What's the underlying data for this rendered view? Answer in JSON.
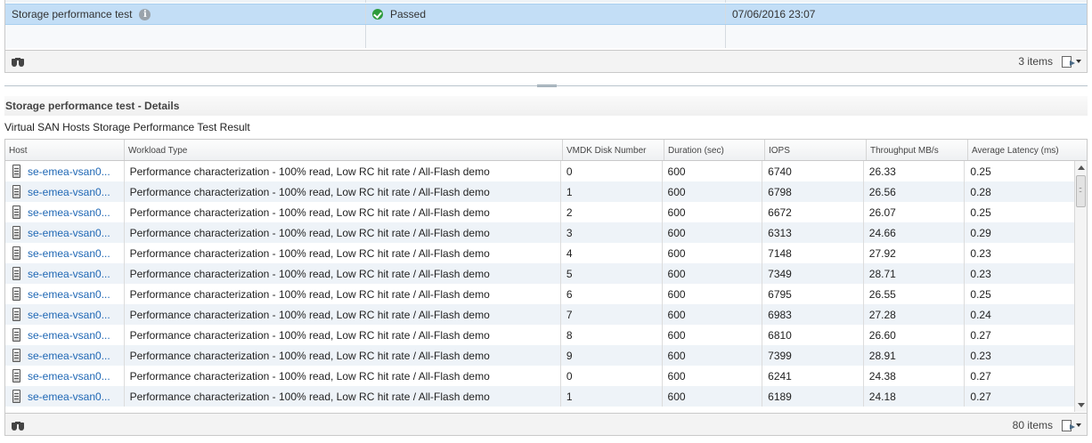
{
  "top_table": {
    "row": {
      "name": "Storage performance test",
      "status": "Passed",
      "timestamp": "07/06/2016 23:07"
    },
    "items_count": "3 items"
  },
  "details": {
    "header": "Storage performance test - Details",
    "subtitle": "Virtual SAN Hosts Storage Performance Test Result",
    "columns": [
      "Host",
      "Workload Type",
      "VMDK Disk Number",
      "Duration (sec)",
      "IOPS",
      "Throughput MB/s",
      "Average Latency (ms)"
    ],
    "rows": [
      {
        "host": "se-emea-vsan0...",
        "workload": "Performance characterization - 100% read, Low RC hit rate / All-Flash demo",
        "disk": "0",
        "duration": "600",
        "iops": "6740",
        "throughput": "26.33",
        "latency": "0.25"
      },
      {
        "host": "se-emea-vsan0...",
        "workload": "Performance characterization - 100% read, Low RC hit rate / All-Flash demo",
        "disk": "1",
        "duration": "600",
        "iops": "6798",
        "throughput": "26.56",
        "latency": "0.28"
      },
      {
        "host": "se-emea-vsan0...",
        "workload": "Performance characterization - 100% read, Low RC hit rate / All-Flash demo",
        "disk": "2",
        "duration": "600",
        "iops": "6672",
        "throughput": "26.07",
        "latency": "0.25"
      },
      {
        "host": "se-emea-vsan0...",
        "workload": "Performance characterization - 100% read, Low RC hit rate / All-Flash demo",
        "disk": "3",
        "duration": "600",
        "iops": "6313",
        "throughput": "24.66",
        "latency": "0.29"
      },
      {
        "host": "se-emea-vsan0...",
        "workload": "Performance characterization - 100% read, Low RC hit rate / All-Flash demo",
        "disk": "4",
        "duration": "600",
        "iops": "7148",
        "throughput": "27.92",
        "latency": "0.23"
      },
      {
        "host": "se-emea-vsan0...",
        "workload": "Performance characterization - 100% read, Low RC hit rate / All-Flash demo",
        "disk": "5",
        "duration": "600",
        "iops": "7349",
        "throughput": "28.71",
        "latency": "0.23"
      },
      {
        "host": "se-emea-vsan0...",
        "workload": "Performance characterization - 100% read, Low RC hit rate / All-Flash demo",
        "disk": "6",
        "duration": "600",
        "iops": "6795",
        "throughput": "26.55",
        "latency": "0.25"
      },
      {
        "host": "se-emea-vsan0...",
        "workload": "Performance characterization - 100% read, Low RC hit rate / All-Flash demo",
        "disk": "7",
        "duration": "600",
        "iops": "6983",
        "throughput": "27.28",
        "latency": "0.24"
      },
      {
        "host": "se-emea-vsan0...",
        "workload": "Performance characterization - 100% read, Low RC hit rate / All-Flash demo",
        "disk": "8",
        "duration": "600",
        "iops": "6810",
        "throughput": "26.60",
        "latency": "0.27"
      },
      {
        "host": "se-emea-vsan0...",
        "workload": "Performance characterization - 100% read, Low RC hit rate / All-Flash demo",
        "disk": "9",
        "duration": "600",
        "iops": "7399",
        "throughput": "28.91",
        "latency": "0.23"
      },
      {
        "host": "se-emea-vsan0...",
        "workload": "Performance characterization - 100% read, Low RC hit rate / All-Flash demo",
        "disk": "0",
        "duration": "600",
        "iops": "6241",
        "throughput": "24.38",
        "latency": "0.27"
      },
      {
        "host": "se-emea-vsan0...",
        "workload": "Performance characterization - 100% read, Low RC hit rate / All-Flash demo",
        "disk": "1",
        "duration": "600",
        "iops": "6189",
        "throughput": "24.18",
        "latency": "0.27"
      }
    ],
    "items_count": "80 items"
  },
  "icons": {
    "info": "info-icon",
    "status": "check-circle-icon",
    "host": "server-icon",
    "filter": "binoculars-icon",
    "export": "export-icon"
  },
  "colors": {
    "selected_row": "#c3def6",
    "link": "#2068b5",
    "passed": "#2e9b3c",
    "alt_row": "#eef3f8"
  }
}
